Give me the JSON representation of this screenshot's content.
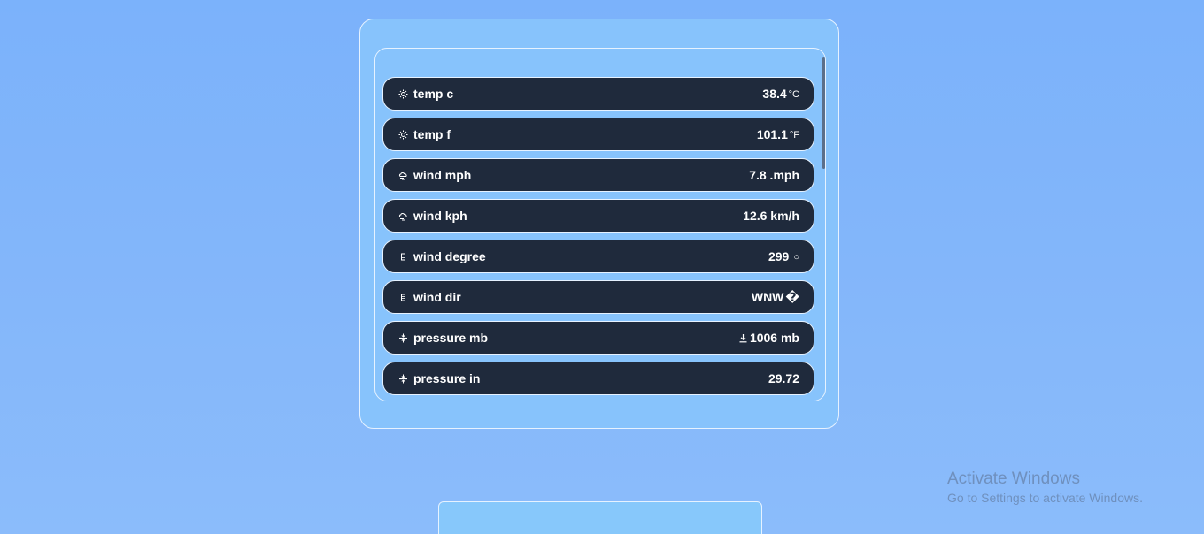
{
  "weather": {
    "rows": [
      {
        "label": "temp c",
        "value": "38.4",
        "unit": "°C",
        "icon": "sun-icon"
      },
      {
        "label": "temp f",
        "value": "101.1",
        "unit": "°F",
        "icon": "sun-icon"
      },
      {
        "label": "wind mph",
        "value": "7.8 .mph",
        "unit": "",
        "icon": "wind-cloud-icon"
      },
      {
        "label": "wind kph",
        "value": "12.6 km/h",
        "unit": "",
        "icon": "wind-cloud-icon"
      },
      {
        "label": "wind degree",
        "value": "299",
        "unit": "○",
        "icon": "compass-icon"
      },
      {
        "label": "wind dir",
        "value": "WNW",
        "unit": "�",
        "icon": "compass-icon"
      },
      {
        "label": "pressure mb",
        "value": "1006 mb",
        "unit": "",
        "icon": "pressure-icon"
      },
      {
        "label": "pressure in",
        "value": "29.72",
        "unit": "",
        "icon": "pressure-icon"
      }
    ]
  },
  "watermark": {
    "title": "Activate Windows",
    "subtitle": "Go to Settings to activate Windows."
  }
}
